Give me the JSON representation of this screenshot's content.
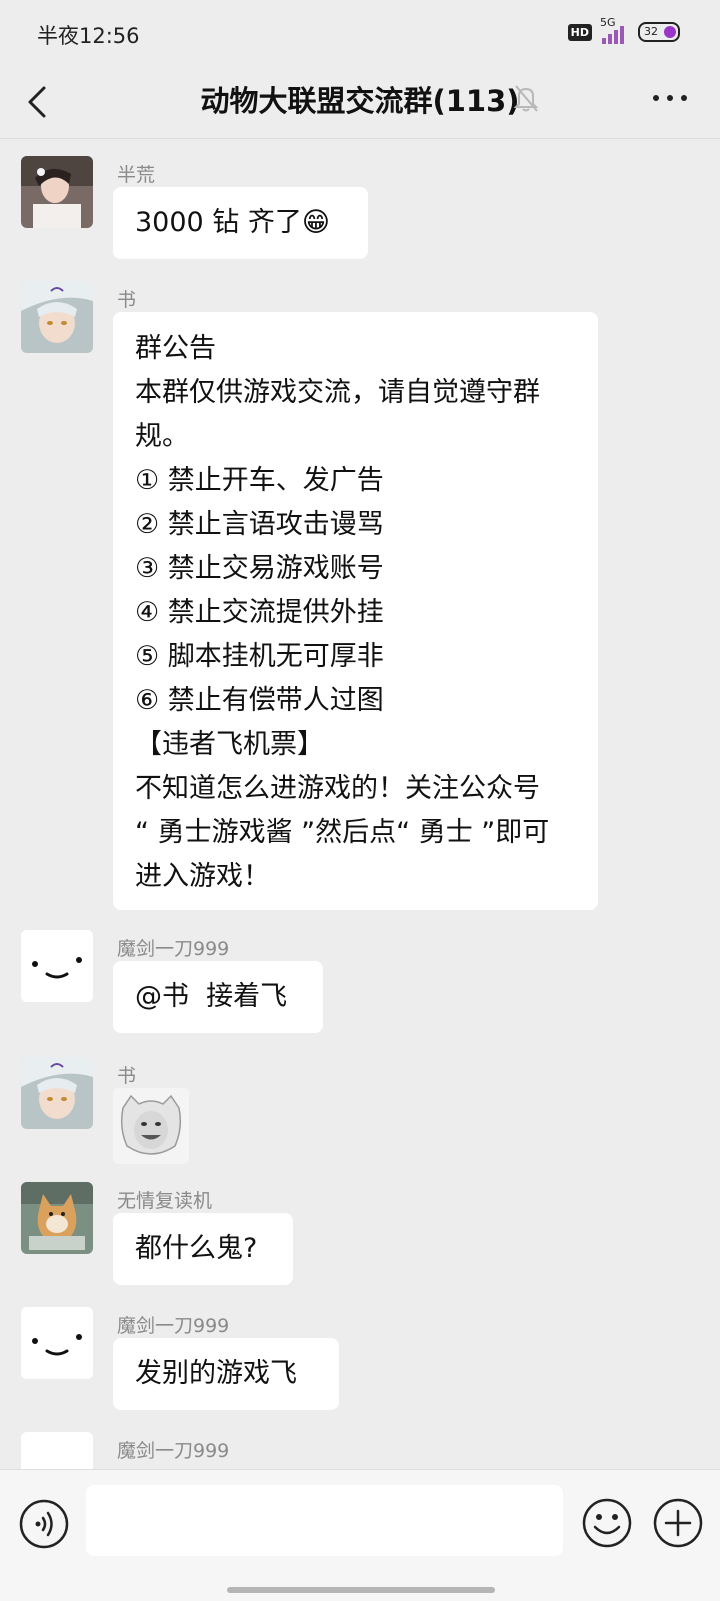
{
  "status_bar": {
    "time": "半夜12:56",
    "hd_label": "HD",
    "network_label": "5G",
    "battery": "32"
  },
  "header": {
    "title": "动物大联盟交流群(113)",
    "icons": [
      "back-arrow-icon",
      "bell-muted-icon",
      "more-dots-icon"
    ]
  },
  "messages": [
    {
      "sender": "半荒",
      "type": "text",
      "lines": [
        "3000 钻 齐了😁"
      ]
    },
    {
      "sender": "书",
      "type": "text",
      "lines": [
        "群公告",
        "本群仅供游戏交流，请自觉遵守群",
        "规。",
        "① 禁止开车、发广告",
        "② 禁止言语攻击谩骂",
        "③ 禁止交易游戏账号",
        "④ 禁止交流提供外挂",
        "⑤ 脚本挂机无可厚非",
        "⑥ 禁止有偿带人过图",
        "【违者飞机票】",
        "不知道怎么进游戏的！关注公众号",
        "“ 勇士游戏酱 ”然后点“ 勇士 ”即可",
        "进入游戏！"
      ]
    },
    {
      "sender": "魔剑一刀999",
      "type": "text",
      "lines": [
        "@书  接着飞"
      ]
    },
    {
      "sender": "书",
      "type": "sticker"
    },
    {
      "sender": "无情复读机",
      "type": "text",
      "lines": [
        "都什么鬼?"
      ]
    },
    {
      "sender": "魔剑一刀999",
      "type": "text",
      "lines": [
        "发别的游戏飞"
      ]
    },
    {
      "sender": "魔剑一刀999",
      "type": "partial"
    }
  ],
  "input_bar": {
    "placeholder": "",
    "icons": [
      "voice-icon",
      "emoji-icon",
      "plus-icon"
    ]
  },
  "colors": {
    "background": "#ededed",
    "bubble": "#ffffff",
    "sender_name": "#8a8a8a",
    "signal": "#9b59b6"
  }
}
